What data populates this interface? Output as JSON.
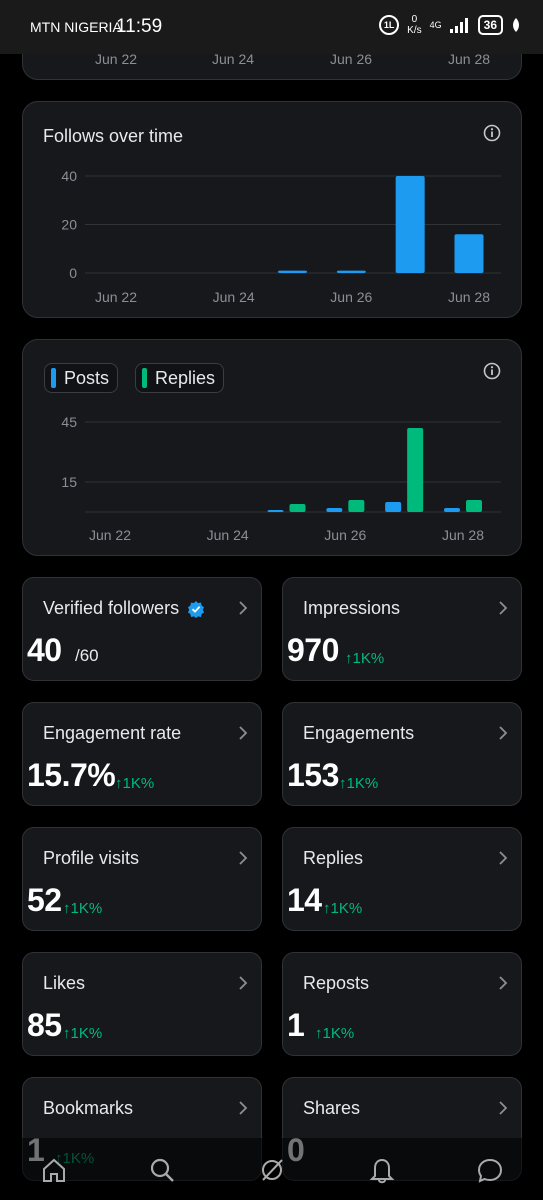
{
  "status_bar": {
    "carrier": "MTN NIGERIA",
    "time": "11:59",
    "data_badge": "1L",
    "speed_value": "0",
    "speed_unit": "K/s",
    "network": "4G",
    "battery": "36"
  },
  "top_card": {
    "x_ticks": [
      "Jun 22",
      "Jun 24",
      "Jun 26",
      "Jun 28"
    ]
  },
  "follows_card": {
    "title": "Follows over time",
    "icon": "info-icon"
  },
  "posts_card": {
    "legend": [
      "Posts",
      "Replies"
    ],
    "icon": "info-icon"
  },
  "chart_data": [
    {
      "type": "bar",
      "title": "Follows over time",
      "categories": [
        "Jun 22",
        "Jun 23",
        "Jun 24",
        "Jun 25",
        "Jun 26",
        "Jun 27",
        "Jun 28"
      ],
      "values": [
        0,
        0,
        0,
        1,
        1,
        40,
        16
      ],
      "x_ticks": [
        "Jun 22",
        "Jun 24",
        "Jun 26",
        "Jun 28"
      ],
      "y_ticks": [
        0,
        20,
        40
      ],
      "ylim": [
        0,
        40
      ],
      "color": "#1d9bf0",
      "grid": true
    },
    {
      "type": "bar",
      "categories": [
        "Jun 22",
        "Jun 23",
        "Jun 24",
        "Jun 25",
        "Jun 26",
        "Jun 27",
        "Jun 28"
      ],
      "series": [
        {
          "name": "Posts",
          "values": [
            0,
            0,
            0,
            1,
            2,
            5,
            2
          ],
          "color": "#1d9bf0"
        },
        {
          "name": "Replies",
          "values": [
            0,
            0,
            0,
            4,
            6,
            42,
            6
          ],
          "color": "#00ba7c"
        }
      ],
      "x_ticks": [
        "Jun 22",
        "Jun 24",
        "Jun 26",
        "Jun 28"
      ],
      "y_ticks": [
        15,
        45
      ],
      "ylim": [
        0,
        45
      ],
      "legend": "top-left",
      "grid": true
    }
  ],
  "metrics": [
    {
      "label": "Verified followers",
      "value": "40",
      "sub": "/60",
      "change": "",
      "verified": true
    },
    {
      "label": "Impressions",
      "value": "970",
      "sub": "",
      "change": "1K%"
    },
    {
      "label": "Engagement rate",
      "value": "15.7%",
      "sub": "",
      "change": "1K%"
    },
    {
      "label": "Engagements",
      "value": "153",
      "sub": "",
      "change": "1K%"
    },
    {
      "label": "Profile visits",
      "value": "52",
      "sub": "",
      "change": "1K%"
    },
    {
      "label": "Replies",
      "value": "14",
      "sub": "",
      "change": "1K%"
    },
    {
      "label": "Likes",
      "value": "85",
      "sub": "",
      "change": "1K%"
    },
    {
      "label": "Reposts",
      "value": "1",
      "sub": "",
      "change": "1K%"
    },
    {
      "label": "Bookmarks",
      "value": "1",
      "sub": "",
      "change": "1K%"
    },
    {
      "label": "Shares",
      "value": "0",
      "sub": "",
      "change": ""
    }
  ],
  "nav": [
    "home-icon",
    "search-icon",
    "grok-icon",
    "notifications-icon",
    "messages-icon"
  ],
  "colors": {
    "accent": "#1d9bf0",
    "positive": "#00ba7c",
    "card": "#16181c"
  }
}
